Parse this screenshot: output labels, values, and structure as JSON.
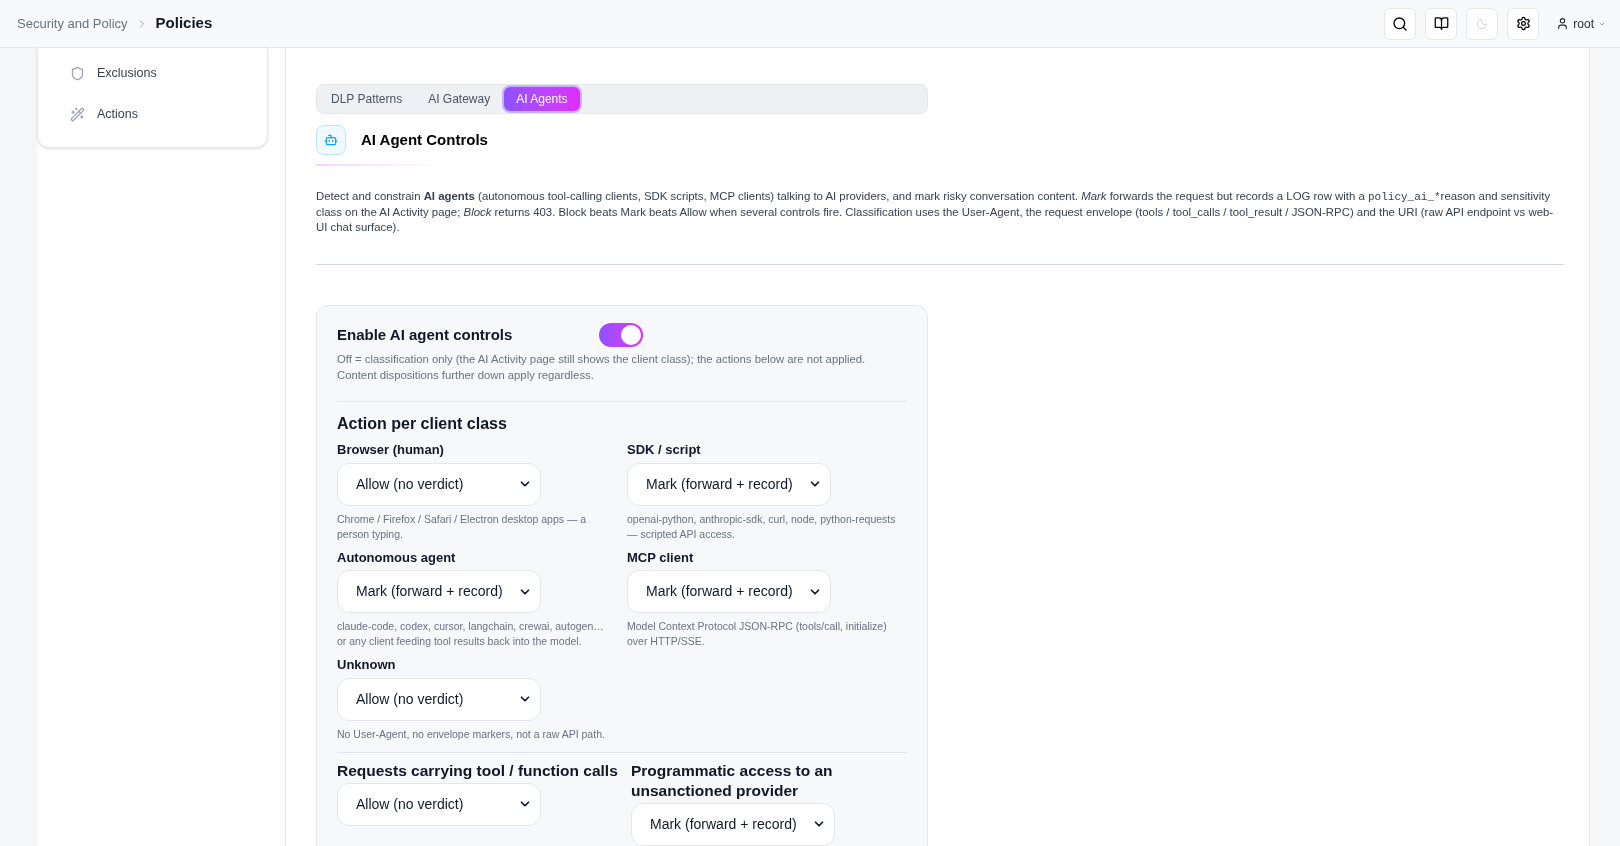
{
  "breadcrumb": {
    "parent": "Security and Policy",
    "current": "Policies"
  },
  "user": {
    "name": "root"
  },
  "sidebar": {
    "items": [
      {
        "label": "Exclusions"
      },
      {
        "label": "Actions"
      }
    ]
  },
  "tabs": [
    {
      "label": "DLP Patterns",
      "selected": false
    },
    {
      "label": "AI Gateway",
      "selected": false
    },
    {
      "label": "AI Agents",
      "selected": true
    }
  ],
  "section": {
    "title": "AI Agent Controls",
    "description": [
      {
        "kind": "text",
        "text": "Detect and constrain **AI agents** (autonomous tool-calling clients, SDK scripts, MCP clients) talking to AI providers, and mark risky conversation content. *Mark* forwards the request but records a LOG row with a "
      },
      {
        "kind": "code",
        "text": "policy_ai_*"
      },
      {
        "kind": "text",
        "text": "reason and sensitivity class on the AI Activity page; *Block* returns 403. Block beats Mark beats Allow when several controls fire. Classification uses the User-Agent, the request envelope (tools / tool_calls / tool_result / JSON-RPC) and the URI (raw API endpoint vs web-UI chat surface)."
      }
    ]
  },
  "enable": {
    "label": "Enable AI agent controls",
    "on": true,
    "hint": "Off = classification only (the AI Activity page still shows the client class); the actions below are not applied. Content dispositions further down apply regardless."
  },
  "client_class": {
    "title": "Action per client class",
    "fields": [
      {
        "label": "Browser (human)",
        "value": "Allow (no verdict)",
        "hint": "Chrome / Firefox / Safari / Electron desktop apps — a person typing."
      },
      {
        "label": "SDK / script",
        "value": "Mark (forward + record)",
        "hint": "openai-python, anthropic-sdk, curl, node, python-requests — scripted API access."
      },
      {
        "label": "Autonomous agent",
        "value": "Mark (forward + record)",
        "hint": "claude-code, codex, cursor, langchain, crewai, autogen… or any client feeding tool results back into the model."
      },
      {
        "label": "MCP client",
        "value": "Mark (forward + record)",
        "hint": "Model Context Protocol JSON-RPC (tools/call, initialize) over HTTP/SSE."
      },
      {
        "label": "Unknown",
        "value": "Allow (no verdict)",
        "hint": "No User-Agent, no envelope markers, not a raw API path."
      }
    ]
  },
  "extra_fields": [
    {
      "label": "Requests carrying tool / function calls",
      "value": "Allow (no verdict)"
    },
    {
      "label": "Programmatic access to an unsanctioned provider",
      "value": "Mark (forward + record)"
    }
  ]
}
